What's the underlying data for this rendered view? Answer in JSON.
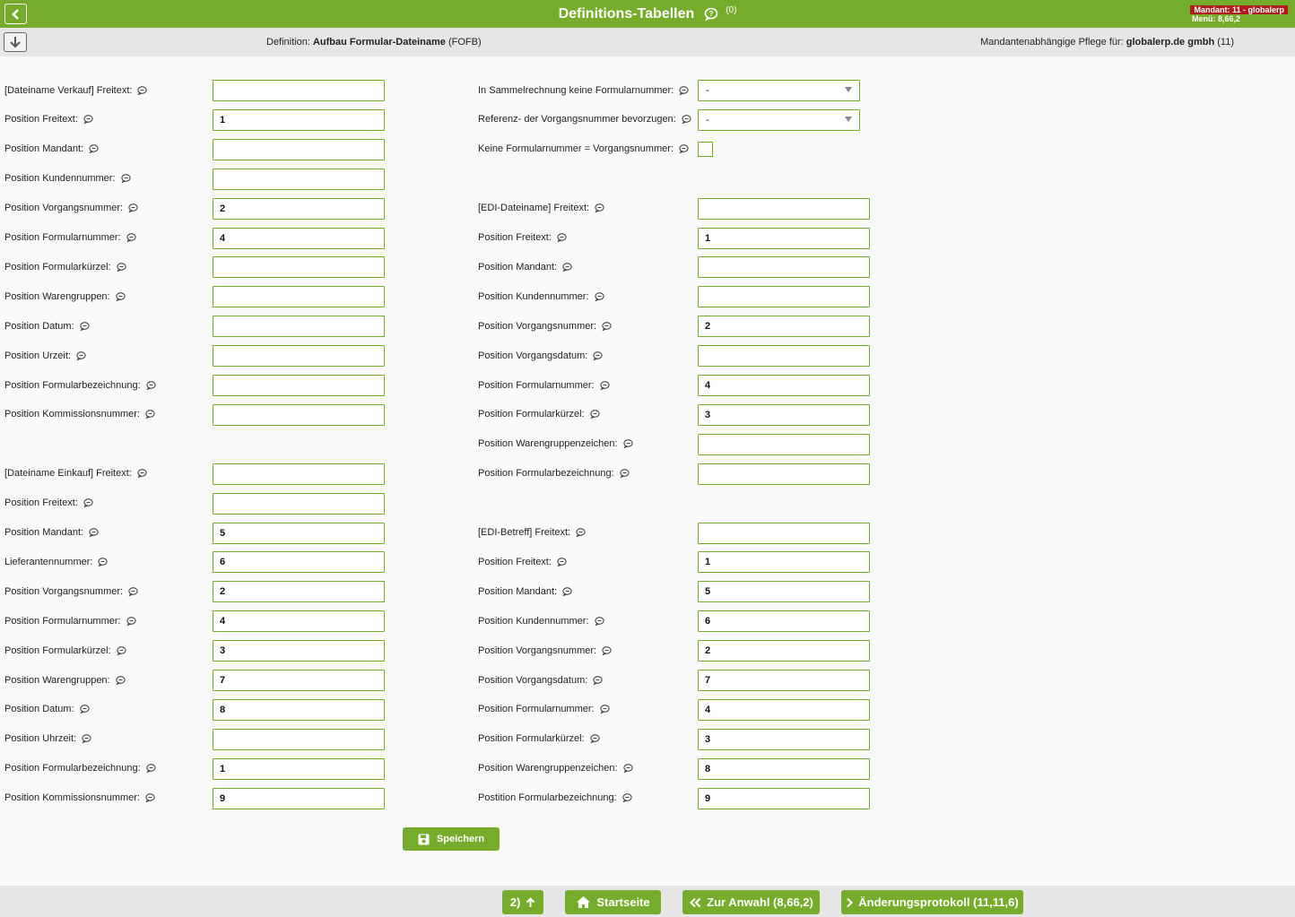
{
  "header": {
    "title": "Definitions-Tabellen",
    "count": "(0)",
    "mandant": "Mandant: 11 - globalerp",
    "menu": "Menü: 8,66,2",
    "accent": "#76ac2c"
  },
  "subbar": {
    "definition_label": "Definition:",
    "definition_value": "Aufbau Formular-Dateiname",
    "definition_code": "(FOFB)",
    "pflege_label": "Mandantenabhängige Pflege für:",
    "pflege_value": "globalerp.de gmbh",
    "pflege_code": "(11)"
  },
  "left_fields": [
    {
      "label": "[Dateiname Verkauf] Freitext:",
      "value": ""
    },
    {
      "label": "Position Freitext:",
      "value": "1"
    },
    {
      "label": "Position Mandant:",
      "value": ""
    },
    {
      "label": "Position Kundennummer:",
      "value": ""
    },
    {
      "label": "Position Vorgangsnummer:",
      "value": "2"
    },
    {
      "label": "Position Formularnummer:",
      "value": "4"
    },
    {
      "label": "Position Formularkürzel:",
      "value": ""
    },
    {
      "label": "Position Warengruppen:",
      "value": ""
    },
    {
      "label": "Position Datum:",
      "value": ""
    },
    {
      "label": "Position Urzeit:",
      "value": ""
    },
    {
      "label": "Position Formularbezeichnung:",
      "value": ""
    },
    {
      "label": "Position Kommissionsnummer:",
      "value": ""
    },
    {
      "label": "[Dateiname Einkauf] Freitext:",
      "value": ""
    },
    {
      "label": "Position Freitext:",
      "value": ""
    },
    {
      "label": "Position Mandant:",
      "value": "5"
    },
    {
      "label": "Lieferantennummer:",
      "value": "6"
    },
    {
      "label": "Position Vorgangsnummer:",
      "value": "2"
    },
    {
      "label": "Position Formularnummer:",
      "value": "4"
    },
    {
      "label": "Position Formularkürzel:",
      "value": "3"
    },
    {
      "label": "Position Warengruppen:",
      "value": "7"
    },
    {
      "label": "Position Datum:",
      "value": "8"
    },
    {
      "label": "Position Uhrzeit:",
      "value": ""
    },
    {
      "label": "Position Formularbezeichnung:",
      "value": "1"
    },
    {
      "label": "Position Kommissionsnummer:",
      "value": "9"
    }
  ],
  "right_options": [
    {
      "label": "In Sammelrechnung keine Formularnummer:",
      "value": "-"
    },
    {
      "label": "Referenz- der Vorgangsnummer bevorzugen:",
      "value": "-"
    },
    {
      "label": "Keine Formularnummer = Vorgangsnummer:",
      "value": ""
    }
  ],
  "right_fields": [
    {
      "label": "[EDI-Dateiname] Freitext:",
      "value": ""
    },
    {
      "label": "Position Freitext:",
      "value": "1"
    },
    {
      "label": "Position Mandant:",
      "value": ""
    },
    {
      "label": "Position Kundennummer:",
      "value": ""
    },
    {
      "label": "Position Vorgangsnummer:",
      "value": "2"
    },
    {
      "label": "Position Vorgangsdatum:",
      "value": ""
    },
    {
      "label": "Position Formularnummer:",
      "value": "4"
    },
    {
      "label": "Position Formularkürzel:",
      "value": "3"
    },
    {
      "label": "Position Warengruppenzeichen:",
      "value": ""
    },
    {
      "label": "Position Formularbezeichnung:",
      "value": ""
    },
    {
      "label": "[EDI-Betreff] Freitext:",
      "value": ""
    },
    {
      "label": "Position Freitext:",
      "value": "1"
    },
    {
      "label": "Position Mandant:",
      "value": "5"
    },
    {
      "label": "Position Kundennummer:",
      "value": "6"
    },
    {
      "label": "Position Vorgangsnummer:",
      "value": "2"
    },
    {
      "label": "Position Vorgangsdatum:",
      "value": "7"
    },
    {
      "label": "Position Formularnummer:",
      "value": "4"
    },
    {
      "label": "Position Formularkürzel:",
      "value": "3"
    },
    {
      "label": "Position Warengruppenzeichen:",
      "value": "8"
    },
    {
      "label": "Postition Formularbezeichnung:",
      "value": "9"
    }
  ],
  "actions": {
    "save": "Speichern"
  },
  "footer": {
    "up": "2)",
    "home": "Startseite",
    "back": "Zur Anwahl (8,66,2)",
    "log": "Änderungsprotokoll (11,11,6)"
  }
}
